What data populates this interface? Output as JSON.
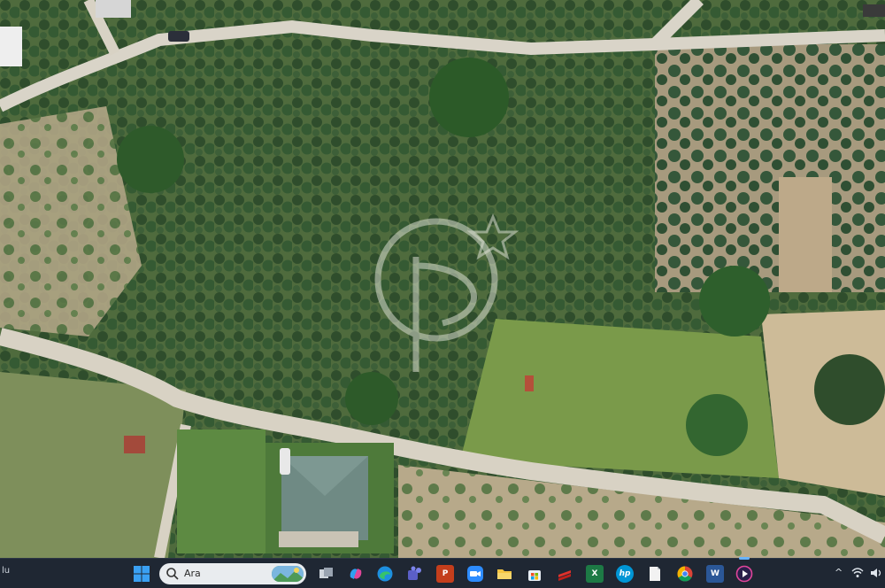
{
  "taskbar": {
    "left_text": "lu",
    "search_placeholder": "Ara",
    "apps": [
      {
        "name": "task-view",
        "label": "",
        "color": "#9aa4b1"
      },
      {
        "name": "copilot",
        "label": "",
        "color": "#b36ae2"
      },
      {
        "name": "edge",
        "label": "",
        "color": "#1d8fe0"
      },
      {
        "name": "teams",
        "label": "",
        "color": "#6264a7"
      },
      {
        "name": "powerpoint",
        "label": "P",
        "color": "#c43e1c"
      },
      {
        "name": "zoom",
        "label": "",
        "color": "#2d8cff"
      },
      {
        "name": "file-explorer",
        "label": "",
        "color": "#f5c542"
      },
      {
        "name": "microsoft-store",
        "label": "",
        "color": "#3a8de0"
      },
      {
        "name": "cloud-app",
        "label": "",
        "color": "#e0312b"
      },
      {
        "name": "excel",
        "label": "X",
        "color": "#1d7a45"
      },
      {
        "name": "hp",
        "label": "hp",
        "color": "#0096d6"
      },
      {
        "name": "notepad",
        "label": "",
        "color": "#f2f2f2"
      },
      {
        "name": "chrome",
        "label": "",
        "color": "#e9b82c"
      },
      {
        "name": "word",
        "label": "W",
        "color": "#2b5797"
      },
      {
        "name": "media-player",
        "label": "",
        "color": "#7a3fd1"
      }
    ],
    "tray": {
      "chevron": "^",
      "wifi_icon": "wifi-icon",
      "volume_icon": "volume-icon"
    }
  }
}
